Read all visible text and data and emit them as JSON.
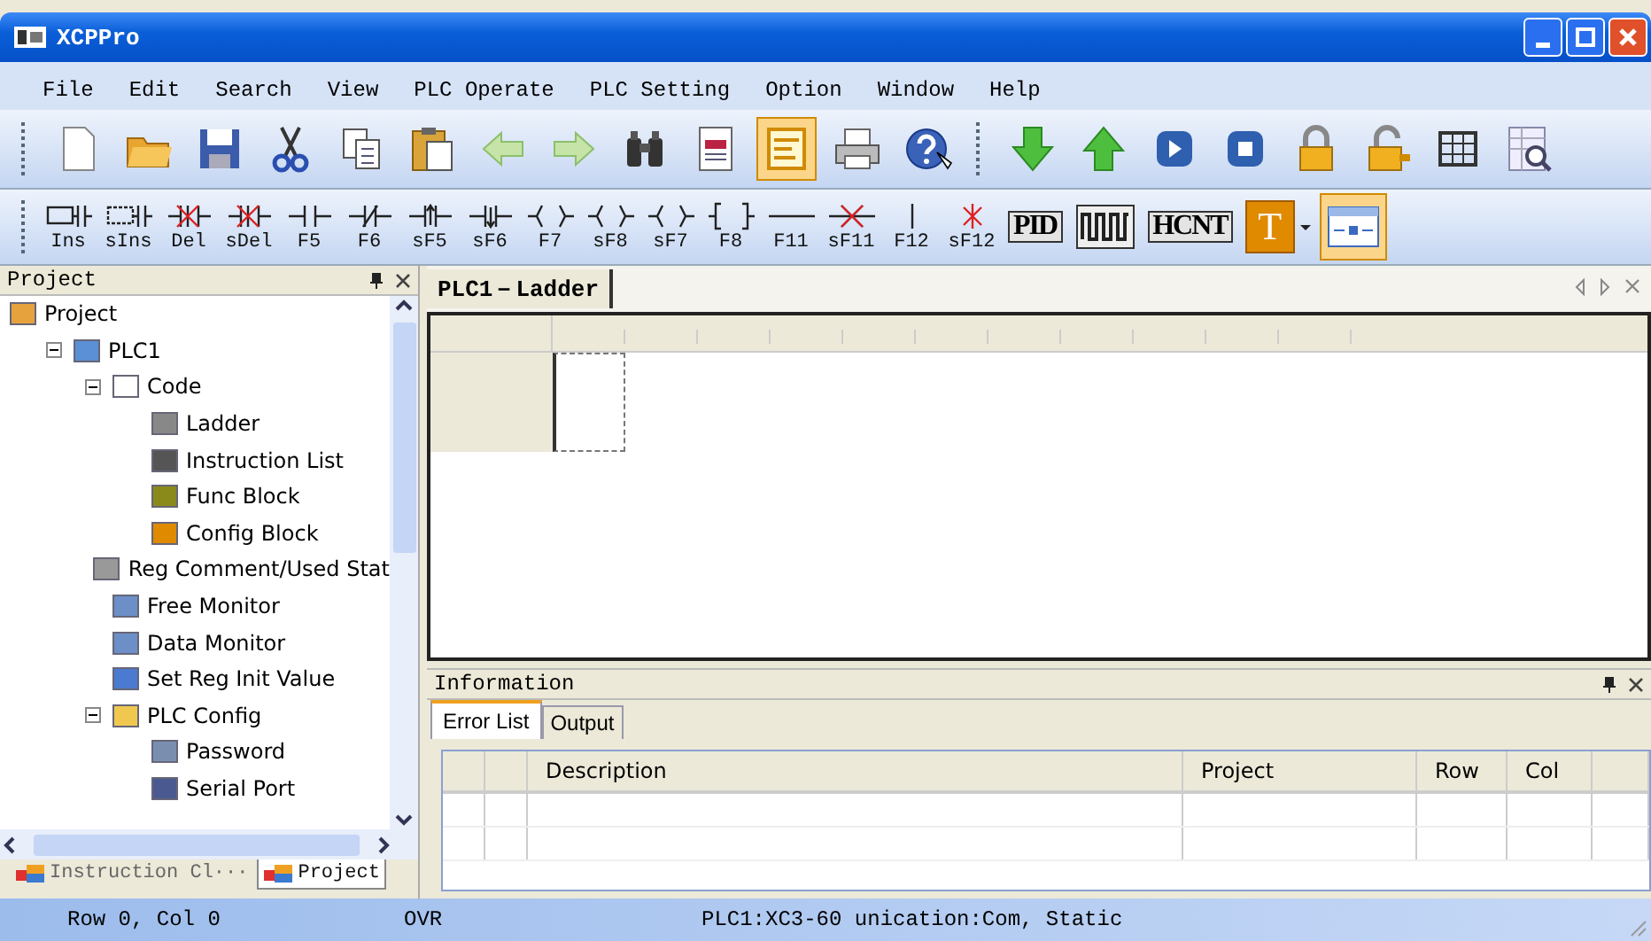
{
  "window": {
    "title": "XCPPro"
  },
  "menu": [
    "File",
    "Edit",
    "Search",
    "View",
    "PLC Operate",
    "PLC Setting",
    "Option",
    "Window",
    "Help"
  ],
  "toolbar_main": [
    {
      "buttons": [
        {
          "kind": "new",
          "selected": false
        },
        {
          "kind": "open",
          "selected": false
        },
        {
          "kind": "save",
          "selected": false
        },
        {
          "kind": "cut",
          "selected": false
        },
        {
          "kind": "copy",
          "selected": false
        },
        {
          "kind": "paste",
          "selected": false
        },
        {
          "kind": "back",
          "selected": false
        },
        {
          "kind": "forward",
          "selected": false
        },
        {
          "kind": "find",
          "selected": false
        },
        {
          "kind": "doc",
          "selected": false
        },
        {
          "kind": "panel",
          "selected": true
        },
        {
          "kind": "print",
          "selected": false
        },
        {
          "kind": "help",
          "selected": false
        }
      ]
    },
    {
      "buttons": [
        {
          "kind": "download",
          "selected": false
        },
        {
          "kind": "upload",
          "selected": false
        },
        {
          "kind": "run",
          "selected": false
        },
        {
          "kind": "stop",
          "selected": false
        },
        {
          "kind": "lock",
          "selected": false
        },
        {
          "kind": "unlock",
          "selected": false
        },
        {
          "kind": "grid",
          "selected": false
        },
        {
          "kind": "zoom",
          "selected": false
        }
      ]
    }
  ],
  "toolbar_ladder": [
    {
      "kind": "ins",
      "label": "Ins",
      "selected": false
    },
    {
      "kind": "sins",
      "label": "sIns",
      "selected": false
    },
    {
      "kind": "del",
      "label": "Del",
      "selected": false
    },
    {
      "kind": "sdel",
      "label": "sDel",
      "selected": false
    },
    {
      "kind": "no",
      "label": "F5",
      "selected": false
    },
    {
      "kind": "nc",
      "label": "F6",
      "selected": false
    },
    {
      "kind": "rise",
      "label": "sF5",
      "selected": false
    },
    {
      "kind": "fall",
      "label": "sF6",
      "selected": false
    },
    {
      "kind": "coil",
      "label": "F7",
      "selected": false
    },
    {
      "kind": "coilr",
      "label": "sF8",
      "selected": false
    },
    {
      "kind": "coils",
      "label": "sF7",
      "selected": false
    },
    {
      "kind": "func",
      "label": "F8",
      "selected": false
    },
    {
      "kind": "hline",
      "label": "F11",
      "selected": false
    },
    {
      "kind": "delh",
      "label": "sF11",
      "selected": false
    },
    {
      "kind": "vline",
      "label": "F12",
      "selected": false
    },
    {
      "kind": "delv",
      "label": "sF12",
      "selected": false
    },
    {
      "kind": "text",
      "label": "PID",
      "selected": false
    },
    {
      "kind": "pulse",
      "selected": false
    },
    {
      "kind": "text",
      "label": "HCNT",
      "selected": false
    },
    {
      "kind": "tdrop",
      "label": "T",
      "selected": false
    },
    {
      "kind": "layout",
      "selected": true
    }
  ],
  "project_panel": {
    "title": "Project",
    "tree": [
      {
        "label": "Project",
        "kind": "project",
        "children": [
          {
            "label": "PLC1",
            "kind": "plc",
            "expanded": true,
            "children": [
              {
                "label": "Code",
                "kind": "page",
                "expanded": true,
                "children": [
                  {
                    "label": "Ladder",
                    "kind": "ladder"
                  },
                  {
                    "label": "Instruction List",
                    "kind": "il"
                  },
                  {
                    "label": "Func Block",
                    "kind": "c"
                  },
                  {
                    "label": "Config Block",
                    "kind": "t"
                  }
                ]
              },
              {
                "label": "Reg Comment/Used Stat",
                "kind": "list"
              },
              {
                "label": "Free Monitor",
                "kind": "monitor"
              },
              {
                "label": "Data Monitor",
                "kind": "monitor"
              },
              {
                "label": "Set Reg Init Value",
                "kind": "calendar"
              },
              {
                "label": "PLC Config",
                "kind": "folder",
                "expanded": true,
                "children": [
                  {
                    "label": "Password",
                    "kind": "key"
                  },
                  {
                    "label": "Serial Port",
                    "kind": "port"
                  }
                ]
              }
            ]
          }
        ]
      }
    ]
  },
  "panel_tabs": [
    {
      "label": "Instruction Cl···",
      "selected": false
    },
    {
      "label": "Project",
      "selected": true
    }
  ],
  "editor": {
    "tab": "PLC1－Ladder"
  },
  "information": {
    "title": "Information",
    "tabs": [
      {
        "label": "Error List",
        "selected": true
      },
      {
        "label": "Output",
        "selected": false
      }
    ],
    "columns": [
      "",
      "",
      "Description",
      "Project",
      "Row",
      "Col"
    ]
  },
  "status_bar": [
    "Row 0, Col 0",
    "OVR",
    "PLC1:XC3-60 unication:Com, Static"
  ]
}
